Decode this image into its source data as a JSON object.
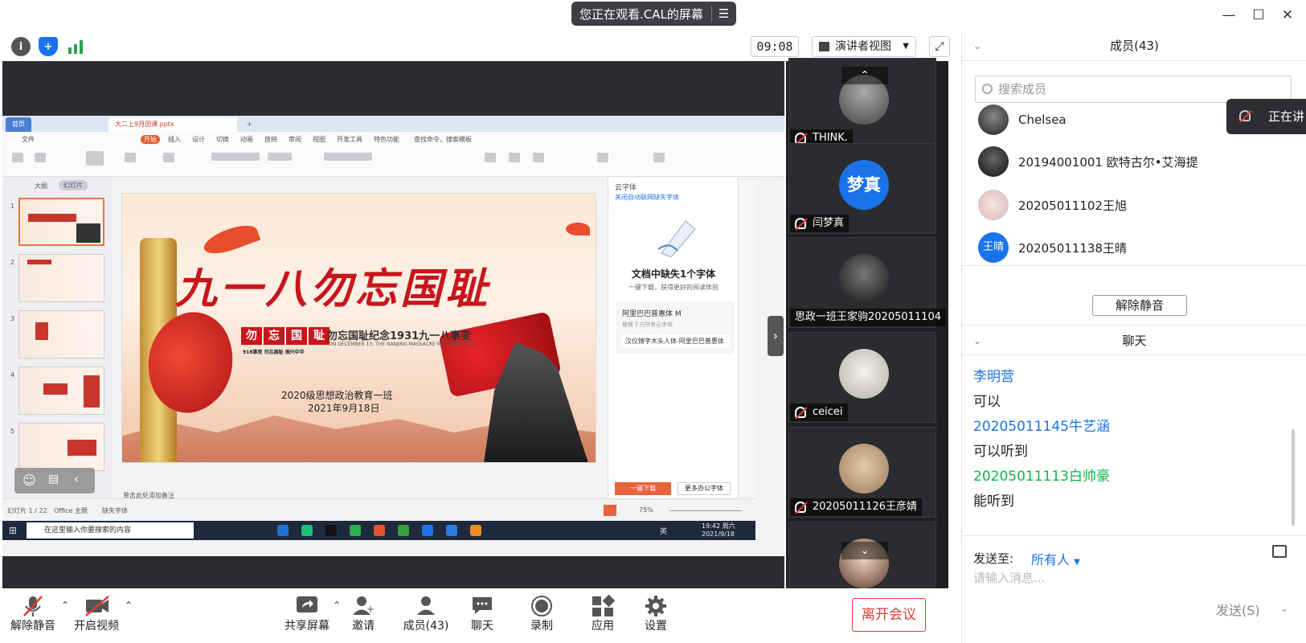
{
  "banner": {
    "text": "您正在观看.CAL的屏幕"
  },
  "toolbar": {
    "clock": "09:08",
    "view_mode": "演讲者视图"
  },
  "shared_window": {
    "tab_home": "首页",
    "tab_doc": "大二上9月团课.pptx",
    "menu": [
      "文件",
      "开始",
      "插入",
      "设计",
      "切换",
      "动画",
      "放映",
      "审阅",
      "视图",
      "开发工具",
      "特色功能"
    ],
    "search_cmd": "查找命令、搜索模板",
    "thumbs_tabs": [
      "大纲",
      "幻灯片"
    ],
    "slide": {
      "title": "九一八勿忘国耻",
      "badge": [
        "勿",
        "忘",
        "国",
        "耻"
      ],
      "subtitle": "勿忘国耻纪念1931九一八事变",
      "subtitle_en": "ON DECEMBER 13, THE NANJING MASSACRE MEMORIAL DAY",
      "caption": "918事变 勿忘国耻 振兴中华",
      "class_name": "2020级思想政治教育一班",
      "date": "2021年9月18日"
    },
    "font_panel": {
      "header": "云字体",
      "link": "关闭自动联网缺失字体",
      "heading": "文档中缺失1个字体",
      "desc": "一键下载，获得更好的阅读体验",
      "font_name": "阿里巴巴普惠体 M",
      "replace_hint": "替换下方所有云字体",
      "font_item": "汉仪铸字木头人体-阿里巴巴普惠体",
      "download_btn": "一键下载",
      "more_btn": "更多办公字体"
    },
    "notes_hint": "单击此处添加备注",
    "status": {
      "slide_no": "幻灯片 1 / 22",
      "theme": "Office 主题",
      "missing_font": "缺失字体",
      "zoom": "75%"
    },
    "taskbar": {
      "search": "在这里输入你要搜索的内容",
      "time": "19:42 周六",
      "date": "2021/9/18",
      "lang": "英"
    }
  },
  "gallery": {
    "tiles": [
      {
        "name": "THINK.",
        "avatar": "image"
      },
      {
        "name": "闫梦真",
        "avatar": "梦真"
      },
      {
        "name": "思政一班王家驹20205011104",
        "avatar": "image"
      },
      {
        "name": "ceicei",
        "avatar": "image"
      },
      {
        "name": "20205011126王彦婧",
        "avatar": "image"
      }
    ]
  },
  "members_panel": {
    "title": "成员(43)",
    "search_placeholder": "搜索成员",
    "members": [
      {
        "name": "Chelsea"
      },
      {
        "name": "20194001001 欧特古尔•艾海提"
      },
      {
        "name": "20205011102王旭"
      },
      {
        "name": "20205011138王晴",
        "avatar_text": "王晴"
      }
    ],
    "unmute_all": "解除静音",
    "toast": "正在讲"
  },
  "chat_panel": {
    "title": "聊天",
    "messages": [
      {
        "sender": "李明营",
        "text": "可以",
        "color": "#1a73e8"
      },
      {
        "sender": "20205011145牛艺涵",
        "text": "可以听到",
        "color": "#1a73e8"
      },
      {
        "sender": "20205011113白帅豪",
        "text": "能听到",
        "color": "#12b34a"
      }
    ],
    "send_to_label": "发送至:",
    "send_to_target": "所有人",
    "input_placeholder": "请输入消息...",
    "send_button": "发送(S)"
  },
  "bottom_bar": {
    "unmute": "解除静音",
    "start_video": "开启视频",
    "share_screen": "共享屏幕",
    "invite": "邀请",
    "members": "成员(43)",
    "chat": "聊天",
    "record": "录制",
    "apps": "应用",
    "settings": "设置",
    "leave": "离开会议"
  }
}
